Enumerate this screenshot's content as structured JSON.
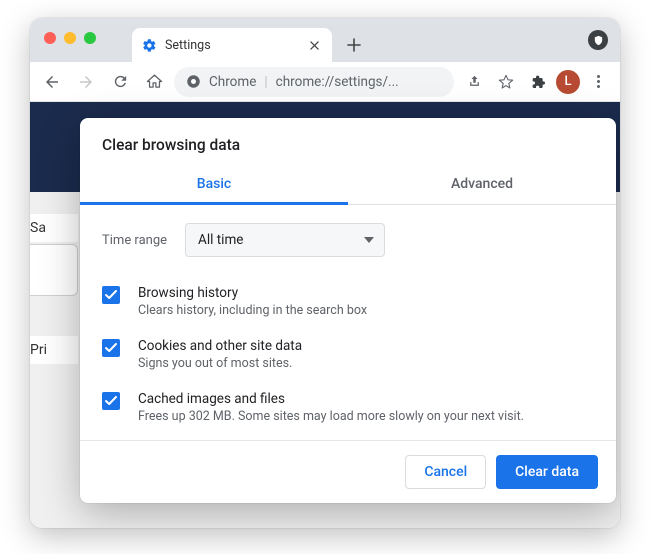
{
  "tab": {
    "title": "Settings"
  },
  "omnibox": {
    "scheme_label": "Chrome",
    "path": "chrome://settings/..."
  },
  "avatar": {
    "initial": "L"
  },
  "bg_labels": {
    "safety": "Sa",
    "privacy": "Pri"
  },
  "dialog": {
    "title": "Clear browsing data",
    "tabs": {
      "basic": "Basic",
      "advanced": "Advanced"
    },
    "time_range_label": "Time range",
    "time_range_value": "All time",
    "items": [
      {
        "title": "Browsing history",
        "sub": "Clears history, including in the search box",
        "checked": true
      },
      {
        "title": "Cookies and other site data",
        "sub": "Signs you out of most sites.",
        "checked": true
      },
      {
        "title": "Cached images and files",
        "sub": "Frees up 302 MB. Some sites may load more slowly on your next visit.",
        "checked": true
      }
    ],
    "buttons": {
      "cancel": "Cancel",
      "clear": "Clear data"
    }
  }
}
